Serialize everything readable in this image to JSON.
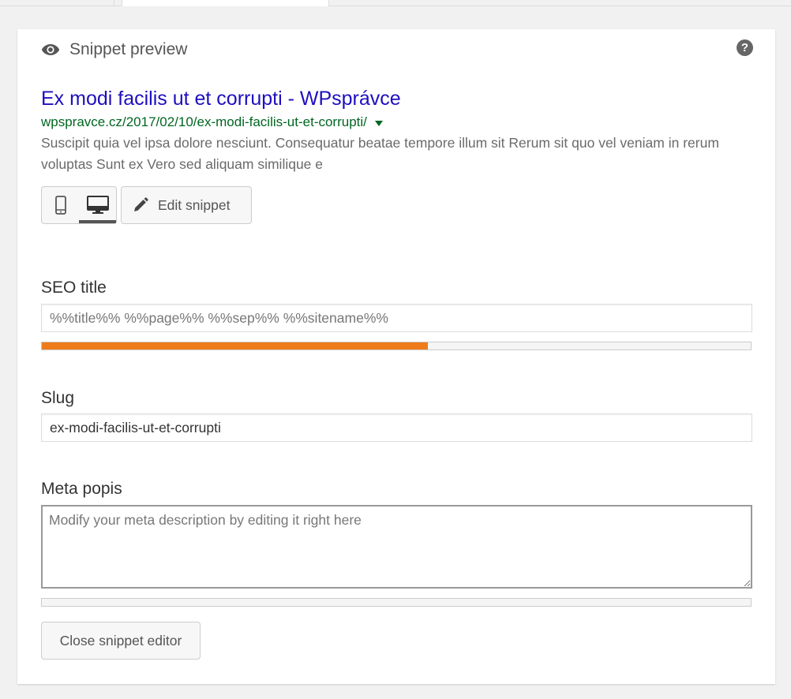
{
  "header": {
    "title": "Snippet preview",
    "help_glyph": "?"
  },
  "preview": {
    "title": "Ex modi facilis ut et corrupti - WPsprávce",
    "url": "wpspravce.cz/2017/02/10/ex-modi-facilis-ut-et-corrupti/",
    "description": "Suscipit quia vel ipsa dolore nesciunt. Consequatur beatae tempore illum sit Rerum sit quo vel veniam in rerum voluptas Sunt ex Vero sed aliquam similique e"
  },
  "mode": {
    "selected": "desktop",
    "icons": [
      "mobile-icon",
      "desktop-icon"
    ]
  },
  "buttons": {
    "edit_snippet": "Edit snippet",
    "close_snippet_editor": "Close snippet editor"
  },
  "fields": {
    "seo_title": {
      "label": "SEO title",
      "placeholder": "%%title%% %%page%% %%sep%% %%sitename%%",
      "value": "",
      "progress_percent": 54.5,
      "progress_color": "#ee7c1b"
    },
    "slug": {
      "label": "Slug",
      "value": "ex-modi-facilis-ut-et-corrupti"
    },
    "meta": {
      "label": "Meta popis",
      "placeholder": "Modify your meta description by editing it right here",
      "value": "",
      "progress_percent": 0
    }
  },
  "colors": {
    "title_link": "#1e0fbe",
    "url_green": "#006621",
    "progress_orange": "#ee7c1b"
  }
}
